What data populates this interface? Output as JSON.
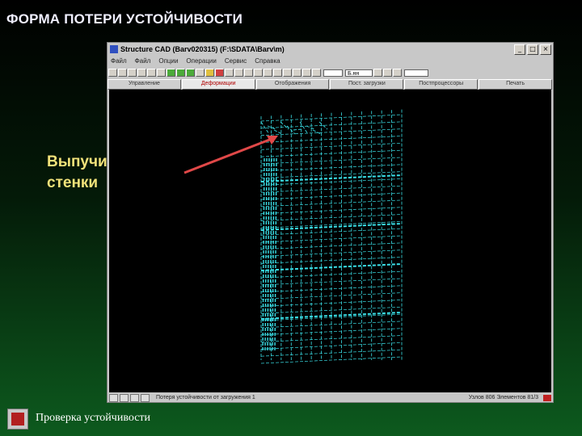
{
  "slide": {
    "title": "ФОРМА ПОТЕРИ УСТОЙЧИВОСТИ",
    "callout_line1": "Выпучивание",
    "callout_line2": "стенки",
    "footer_text": "Проверка устойчивости",
    "callout_color": "#f2e27a",
    "arrow_color": "#e04848"
  },
  "app_window": {
    "title": "Structure CAD (Barv020315) (F:\\SDATA\\Barv\\m)",
    "menu_items": [
      "Файл",
      "Файл",
      "Опции",
      "Операции",
      "Сервис",
      "Справка"
    ],
    "toolbar_combo1": "",
    "toolbar_combo2": "Б.нн",
    "toolbar_combo3": "",
    "tabs": [
      {
        "label": "Управление",
        "active": false
      },
      {
        "label": "Деформации",
        "active": true
      },
      {
        "label": "Отображения",
        "active": false
      },
      {
        "label": "Пост. загрузки",
        "active": false
      },
      {
        "label": "Постпроцессоры",
        "active": false
      },
      {
        "label": "Печать",
        "active": false
      }
    ],
    "status_text": "Потеря устойчивости от загружения 1",
    "status_right": "Узлов 806  Элементов 81/3",
    "mesh_color": "#3ae0e8"
  }
}
